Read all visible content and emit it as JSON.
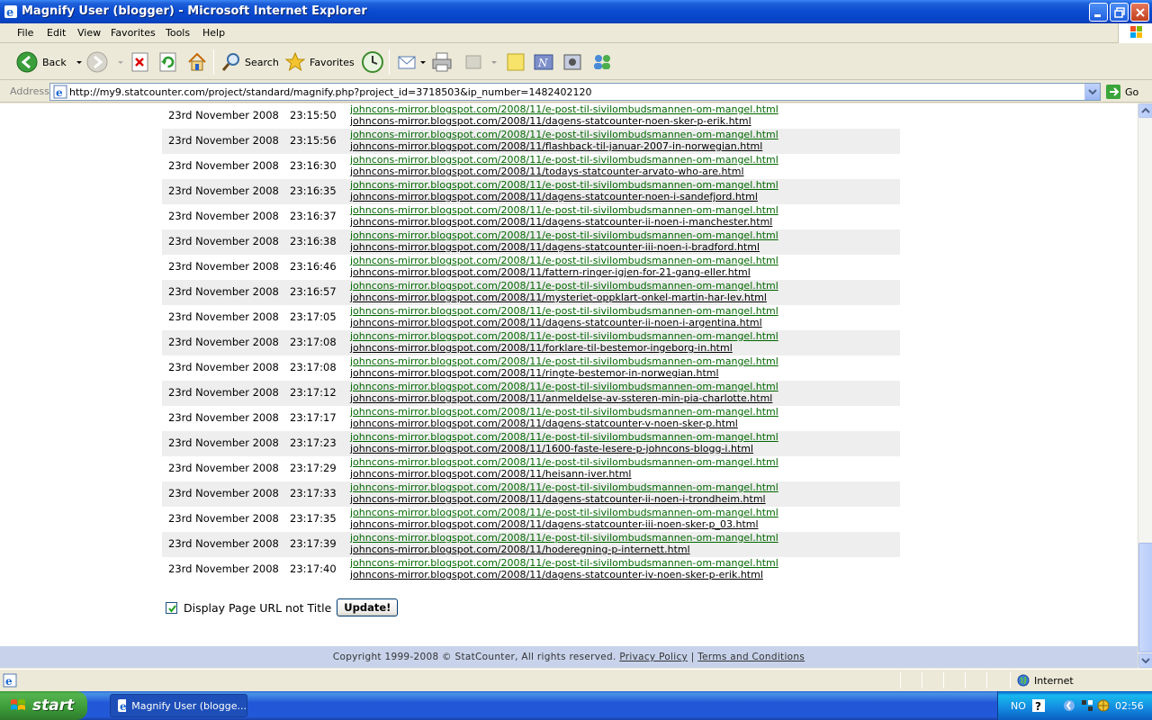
{
  "window": {
    "title": "Magnify User (blogger) - Microsoft Internet Explorer"
  },
  "menu": [
    "File",
    "Edit",
    "View",
    "Favorites",
    "Tools",
    "Help"
  ],
  "toolbar": {
    "back_label": "Back",
    "search_label": "Search",
    "favorites_label": "Favorites"
  },
  "address": {
    "label": "Address",
    "url": "http://my9.statcounter.com/project/standard/magnify.php?project_id=3718503&ip_number=1482402120",
    "go_label": "Go"
  },
  "visits": [
    {
      "date": "23rd November 2008",
      "time": "23:15:50",
      "entry": "johncons-mirror.blogspot.com/2008/11/e-post-til-sivilombudsmannen-om-mangel.html",
      "page": "johncons-mirror.blogspot.com/2008/11/dagens-statcounter-noen-sker-p-erik.html"
    },
    {
      "date": "23rd November 2008",
      "time": "23:15:56",
      "entry": "johncons-mirror.blogspot.com/2008/11/e-post-til-sivilombudsmannen-om-mangel.html",
      "page": "johncons-mirror.blogspot.com/2008/11/flashback-til-januar-2007-in-norwegian.html"
    },
    {
      "date": "23rd November 2008",
      "time": "23:16:30",
      "entry": "johncons-mirror.blogspot.com/2008/11/e-post-til-sivilombudsmannen-om-mangel.html",
      "page": "johncons-mirror.blogspot.com/2008/11/todays-statcounter-arvato-who-are.html"
    },
    {
      "date": "23rd November 2008",
      "time": "23:16:35",
      "entry": "johncons-mirror.blogspot.com/2008/11/e-post-til-sivilombudsmannen-om-mangel.html",
      "page": "johncons-mirror.blogspot.com/2008/11/dagens-statcounter-noen-i-sandefjord.html"
    },
    {
      "date": "23rd November 2008",
      "time": "23:16:37",
      "entry": "johncons-mirror.blogspot.com/2008/11/e-post-til-sivilombudsmannen-om-mangel.html",
      "page": "johncons-mirror.blogspot.com/2008/11/dagens-statcounter-ii-noen-i-manchester.html"
    },
    {
      "date": "23rd November 2008",
      "time": "23:16:38",
      "entry": "johncons-mirror.blogspot.com/2008/11/e-post-til-sivilombudsmannen-om-mangel.html",
      "page": "johncons-mirror.blogspot.com/2008/11/dagens-statcounter-iii-noen-i-bradford.html"
    },
    {
      "date": "23rd November 2008",
      "time": "23:16:46",
      "entry": "johncons-mirror.blogspot.com/2008/11/e-post-til-sivilombudsmannen-om-mangel.html",
      "page": "johncons-mirror.blogspot.com/2008/11/fattern-ringer-igjen-for-21-gang-eller.html"
    },
    {
      "date": "23rd November 2008",
      "time": "23:16:57",
      "entry": "johncons-mirror.blogspot.com/2008/11/e-post-til-sivilombudsmannen-om-mangel.html",
      "page": "johncons-mirror.blogspot.com/2008/11/mysteriet-oppklart-onkel-martin-har-lev.html"
    },
    {
      "date": "23rd November 2008",
      "time": "23:17:05",
      "entry": "johncons-mirror.blogspot.com/2008/11/e-post-til-sivilombudsmannen-om-mangel.html",
      "page": "johncons-mirror.blogspot.com/2008/11/dagens-statcounter-ii-noen-i-argentina.html"
    },
    {
      "date": "23rd November 2008",
      "time": "23:17:08",
      "entry": "johncons-mirror.blogspot.com/2008/11/e-post-til-sivilombudsmannen-om-mangel.html",
      "page": "johncons-mirror.blogspot.com/2008/11/forklare-til-bestemor-ingeborg-in.html"
    },
    {
      "date": "23rd November 2008",
      "time": "23:17:08",
      "entry": "johncons-mirror.blogspot.com/2008/11/e-post-til-sivilombudsmannen-om-mangel.html",
      "page": "johncons-mirror.blogspot.com/2008/11/ringte-bestemor-in-norwegian.html"
    },
    {
      "date": "23rd November 2008",
      "time": "23:17:12",
      "entry": "johncons-mirror.blogspot.com/2008/11/e-post-til-sivilombudsmannen-om-mangel.html",
      "page": "johncons-mirror.blogspot.com/2008/11/anmeldelse-av-ssteren-min-pia-charlotte.html"
    },
    {
      "date": "23rd November 2008",
      "time": "23:17:17",
      "entry": "johncons-mirror.blogspot.com/2008/11/e-post-til-sivilombudsmannen-om-mangel.html",
      "page": "johncons-mirror.blogspot.com/2008/11/dagens-statcounter-v-noen-sker-p.html"
    },
    {
      "date": "23rd November 2008",
      "time": "23:17:23",
      "entry": "johncons-mirror.blogspot.com/2008/11/e-post-til-sivilombudsmannen-om-mangel.html",
      "page": "johncons-mirror.blogspot.com/2008/11/1600-faste-lesere-p-johncons-blogg-i.html"
    },
    {
      "date": "23rd November 2008",
      "time": "23:17:29",
      "entry": "johncons-mirror.blogspot.com/2008/11/e-post-til-sivilombudsmannen-om-mangel.html",
      "page": "johncons-mirror.blogspot.com/2008/11/heisann-iver.html"
    },
    {
      "date": "23rd November 2008",
      "time": "23:17:33",
      "entry": "johncons-mirror.blogspot.com/2008/11/e-post-til-sivilombudsmannen-om-mangel.html",
      "page": "johncons-mirror.blogspot.com/2008/11/dagens-statcounter-ii-noen-i-trondheim.html"
    },
    {
      "date": "23rd November 2008",
      "time": "23:17:35",
      "entry": "johncons-mirror.blogspot.com/2008/11/e-post-til-sivilombudsmannen-om-mangel.html",
      "page": "johncons-mirror.blogspot.com/2008/11/dagens-statcounter-iii-noen-sker-p_03.html"
    },
    {
      "date": "23rd November 2008",
      "time": "23:17:39",
      "entry": "johncons-mirror.blogspot.com/2008/11/e-post-til-sivilombudsmannen-om-mangel.html",
      "page": "johncons-mirror.blogspot.com/2008/11/hoderegning-p-internett.html"
    },
    {
      "date": "23rd November 2008",
      "time": "23:17:40",
      "entry": "johncons-mirror.blogspot.com/2008/11/e-post-til-sivilombudsmannen-om-mangel.html",
      "page": "johncons-mirror.blogspot.com/2008/11/dagens-statcounter-iv-noen-sker-p-erik.html"
    }
  ],
  "options": {
    "display_url_label": "Display Page URL not Title",
    "display_url_checked": true,
    "update_label": "Update!"
  },
  "footer": {
    "copyright": "Copyright 1999-2008 © StatCounter, All rights reserved.",
    "privacy": "Privacy Policy",
    "separator": "|",
    "terms": "Terms and Conditions"
  },
  "status": {
    "zone": "Internet"
  },
  "taskbar": {
    "start": "start",
    "task": "Magnify User (blogge...",
    "lang": "NO",
    "clock": "02:56"
  }
}
